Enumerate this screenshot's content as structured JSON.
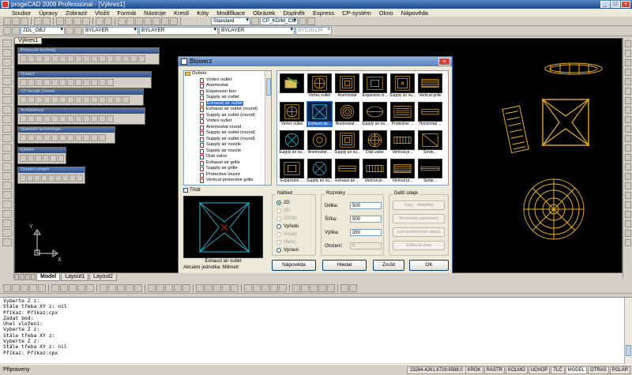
{
  "window": {
    "title": "progeCAD 2009 Professional - [Výkres1]",
    "controls": [
      "_",
      "□",
      "×"
    ]
  },
  "menu": [
    "Soubor",
    "Úpravy",
    "Zobrazit",
    "Vložit",
    "Formát",
    "Nástroje",
    "Kreslí",
    "Kóty",
    "Modifikace",
    "Obrázek",
    "Doplněk",
    "Express",
    "CP-systém",
    "Okno",
    "Nápověda"
  ],
  "toolbar": {
    "style_combo": "Standard",
    "dim_combo": "CP_KDIM_CM",
    "layer_combo": "2DL_OBJ",
    "color_combo": "BYLAYER",
    "linetype_combo": "BYLAYER",
    "lineweight_combo": "BYLAYER",
    "plotstyle_combo": "BYCOLOR"
  },
  "drawing_tab": "Výkres1",
  "layout_tabs": [
    "Model",
    "Layout1",
    "Layout2"
  ],
  "palettes": [
    "Pomocné techniky",
    "Ostatní",
    "CP-Kreslit Zdravé",
    "Architektura",
    "Stavební technologie",
    "Elektro",
    "Ostatní ostatní"
  ],
  "dialog": {
    "title": "Blowerz",
    "close": "×",
    "tree": {
      "root": "Outlets",
      "items": [
        "Vortex outlet",
        "Anemostat",
        "Expansion box",
        "Supply air outlet",
        "Exhaust air outlet",
        "Exhaust air outlet (round)",
        "Supply air outlet (round)",
        "Vortex outlet",
        "Anemostat round",
        "Supply air outlet (round)",
        "Supply air outlet (round)",
        "Supply air nozzle",
        "Supply air nozzle",
        "Disk valve",
        "Exhaust air grille",
        "Supply air grille",
        "Protective louvre",
        "Vertical protective grille"
      ],
      "selected_index": 4
    },
    "thumbs": [
      {
        "caption": "",
        "kind": "folder"
      },
      {
        "caption": "Vortex outlet",
        "kind": "vortex"
      },
      {
        "caption": "Anemostat",
        "kind": "square-rings"
      },
      {
        "caption": "Expansion b...",
        "kind": "expansion"
      },
      {
        "caption": "Supply air ou...",
        "kind": "square-dot"
      },
      {
        "caption": "Vertical grille",
        "kind": "grille"
      },
      {
        "caption": "Vortex outlet",
        "kind": "vortex"
      },
      {
        "caption": "Exhaust air...",
        "kind": "x-square",
        "selected": true
      },
      {
        "caption": "Anemostat ...",
        "kind": "round-rings"
      },
      {
        "caption": "Supply air no...",
        "kind": "nozzle"
      },
      {
        "caption": "Protective ...",
        "kind": "louvre"
      },
      {
        "caption": "Horizontal ...",
        "kind": "hgrille"
      },
      {
        "caption": "Supply air ou...",
        "kind": "round-x"
      },
      {
        "caption": "Anemostat ...",
        "kind": "round-circle"
      },
      {
        "caption": "Supply air ou...",
        "kind": "square-rings"
      },
      {
        "caption": "Disk valve",
        "kind": "disk"
      },
      {
        "caption": "Vertical pr...",
        "kind": "vgrille"
      },
      {
        "caption": "Smok...",
        "kind": "smoke"
      },
      {
        "caption": "Expansion ...",
        "kind": "expansion"
      },
      {
        "caption": "Supply air ou...",
        "kind": "round-x"
      },
      {
        "caption": "Exhaust air ...",
        "kind": "hgrille"
      },
      {
        "caption": "Vertical pr...",
        "kind": "vgrille"
      },
      {
        "caption": "Vertical pr...",
        "kind": "grille"
      },
      {
        "caption": "Slotte...",
        "kind": "slot"
      }
    ],
    "tridit_label": "Třídit",
    "preview_caption": "Exhaust air outlet",
    "units_label": "Aktuální jednotka: Milimetr",
    "nahled": {
      "label": "Náhled",
      "options": [
        "2D",
        "3D",
        "2D/3D",
        "Vpředu",
        "Vzadu",
        "Vlevo",
        "Vpravo"
      ],
      "selected_index": 0,
      "disabled": [
        1,
        2,
        4,
        5
      ]
    },
    "rozmery": {
      "label": "Rozměry",
      "fields": [
        {
          "label": "Délka:",
          "value": "500"
        },
        {
          "label": "Šířka:",
          "value": "500"
        },
        {
          "label": "Výška:",
          "value": "350"
        },
        {
          "label": "Otočení:",
          "value": "0"
        }
      ]
    },
    "dalsi": {
      "label": "Další údaje",
      "buttons": [
        "Typy - doladění",
        "Technické parametry",
        "List technických údajů",
        "Editovat data"
      ]
    },
    "buttons": {
      "help": "Nápověda",
      "search": "Hledat",
      "cancel": "Zrušit",
      "ok": "OK"
    }
  },
  "command_lines": [
    "Vyberte Z z:",
    "Stále třeba XY z: nil",
    "Příkaz: Příkaz:cpx",
    "Zadat bod:",
    "Úhel vložení:",
    "Vyberte Z z:",
    "Stále třeba XY z:",
    "Vyberte Z z:",
    "Stále třeba XY z: nil",
    "Příkaz: Příkaz:cpx"
  ],
  "status": {
    "ready": "Připraveny",
    "coords": "23264.4261,6729.6588,0",
    "toggles": [
      "KROK",
      "RASTR",
      "KOLMO",
      "UCHOP",
      "TLČ",
      "MODEL",
      "OTRAS",
      "POLÁR"
    ],
    "on": [
      5
    ]
  },
  "colors": {
    "cad_yellow": "#e8b020",
    "cad_cyan": "#2fc6e0",
    "cad_red": "#e02020",
    "selection": "#316ac5"
  }
}
